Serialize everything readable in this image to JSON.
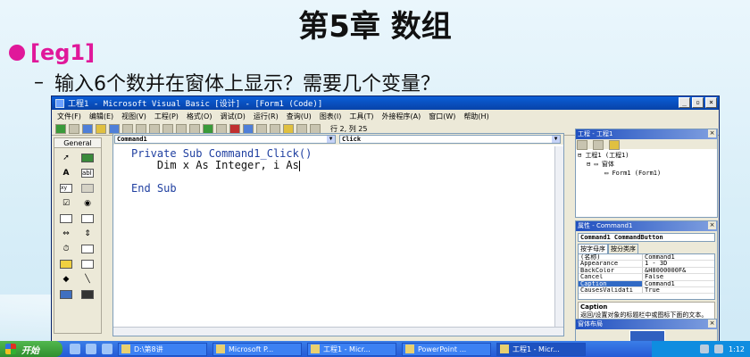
{
  "slide": {
    "title": "第5章 数组",
    "bullet": "[eg1]",
    "subtext": "输入6个数并在窗体上显示？需要几个变量？",
    "dash": "–"
  },
  "colors": {
    "bullet": "#e0189a",
    "title_bar": "#0a5fd8",
    "taskbar": "#245ad6"
  },
  "vb": {
    "title": "工程1 - Microsoft Visual Basic [设计] - [Form1 (Code)]",
    "menu": [
      "文件(F)",
      "编辑(E)",
      "视图(V)",
      "工程(P)",
      "格式(O)",
      "调试(D)",
      "运行(R)",
      "查询(U)",
      "图表(I)",
      "工具(T)",
      "外接程序(A)",
      "窗口(W)",
      "帮助(H)"
    ],
    "position": "行 2, 列 25",
    "toolbox": {
      "header": "General",
      "a_label": "A",
      "ab_label": "abl",
      "xy_label": "xy"
    },
    "code": {
      "object_combo": "Command1",
      "proc_combo": "Click",
      "lines": [
        "Private Sub Command1_Click()",
        "    Dim x As Integer, i As",
        "",
        "End Sub"
      ]
    },
    "project": {
      "title": "工程 - 工程1",
      "tree": [
        "工程1 (工程1)",
        "窗体",
        "Form1 (Form1)"
      ]
    },
    "properties": {
      "title": "属性 - Command1",
      "object": "Command1 CommandButton",
      "tabs": [
        "按字母序",
        "按分类序"
      ],
      "rows": [
        {
          "name": "(名称)",
          "value": "Command1"
        },
        {
          "name": "Appearance",
          "value": "1 - 3D"
        },
        {
          "name": "BackColor",
          "value": "&H8000000F&"
        },
        {
          "name": "Cancel",
          "value": "False"
        },
        {
          "name": "Caption",
          "value": "Command1"
        },
        {
          "name": "CausesValidati",
          "value": "True"
        }
      ],
      "desc_title": "Caption",
      "desc_text": "返回/设置对象的标题栏中或图标下面的文本。"
    },
    "layout_title": "窗体布局"
  },
  "taskbar": {
    "start": "开始",
    "tasks": [
      "D:\\第8讲",
      "Microsoft P...",
      "工程1 - Micr...",
      "PowerPoint ...",
      "工程1 - Micr..."
    ],
    "time": "1:12"
  }
}
